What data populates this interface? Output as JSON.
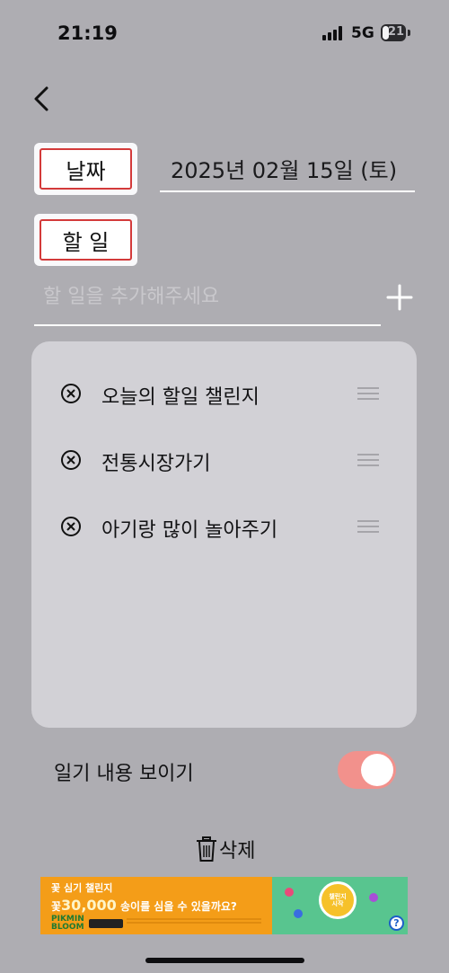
{
  "status_bar": {
    "time": "21:19",
    "network": "5G",
    "battery": "21"
  },
  "form": {
    "date_label": "날짜",
    "date_value": "2025년 02월 15일 (토)",
    "task_label": "할 일",
    "task_placeholder": "할 일을 추가해주세요",
    "task_value": ""
  },
  "todos": [
    {
      "text": "오늘의 할일 챌린지"
    },
    {
      "text": "전통시장가기"
    },
    {
      "text": "아기랑 많이 놀아주기"
    }
  ],
  "toggle": {
    "label": "일기 내용 보이기",
    "on": true,
    "color": "#f2918c"
  },
  "delete_label": "삭제",
  "ad": {
    "line1": "꽃 심기 챌린지",
    "line2_prefix": "꽃",
    "line2_number": "30,000",
    "line2_suffix": "송이를 심을 수 있을까요?",
    "brand_line1": "PIKMIN",
    "brand_line2": "BLOOM",
    "badge_line1": "챌린지",
    "badge_line2": "시작",
    "info_icon": "?"
  },
  "colors": {
    "background": "#aeadb2",
    "card": "#d2d1d6",
    "label_border": "#d33a3a",
    "toggle_on": "#f2918c"
  }
}
